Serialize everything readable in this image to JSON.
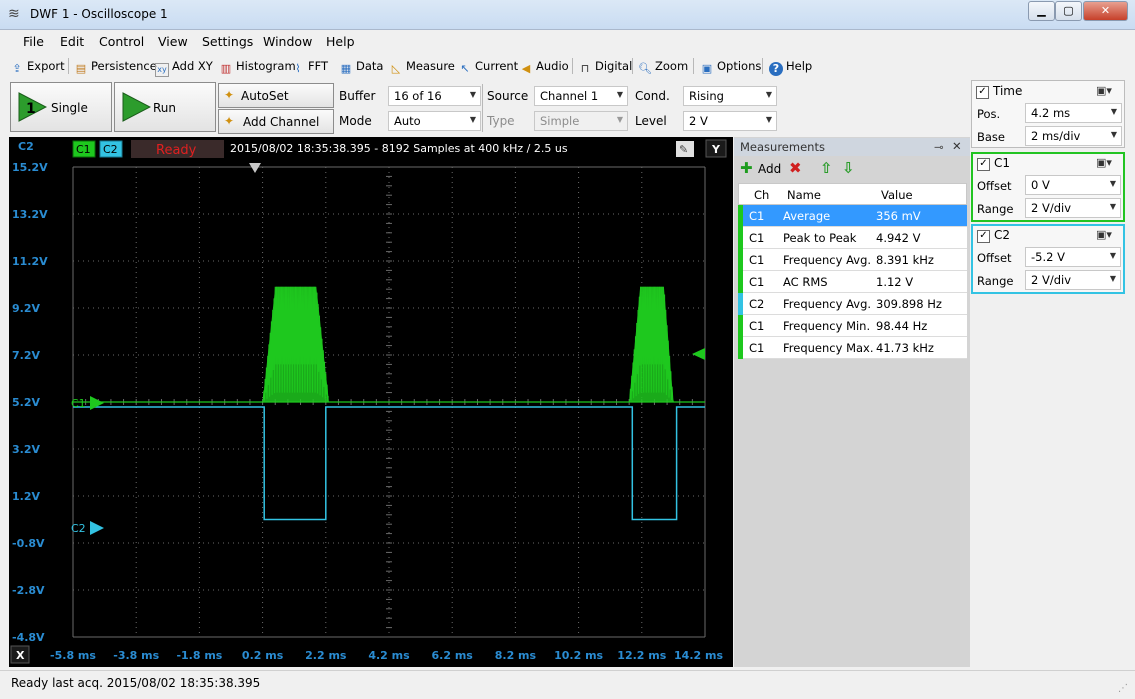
{
  "window": {
    "title": "DWF 1 - Oscilloscope 1"
  },
  "menu": [
    "File",
    "Edit",
    "Control",
    "View",
    "Settings",
    "Window",
    "Help"
  ],
  "toolbar": {
    "export": "Export",
    "persistence": "Persistence",
    "add_xy": "Add XY",
    "histogram": "Histogram",
    "fft": "FFT",
    "data": "Data",
    "measure": "Measure",
    "current": "Current",
    "audio": "Audio",
    "digital": "Digital",
    "zoom": "Zoom",
    "options": "Options",
    "help": "Help"
  },
  "controls": {
    "single_label": "Single",
    "single_badge": "1",
    "run_label": "Run",
    "autoset_label": "AutoSet",
    "add_channel_label": "Add Channel",
    "buffer_label": "Buffer",
    "buffer_value": "16 of 16",
    "mode_label": "Mode",
    "mode_value": "Auto",
    "source_label": "Source",
    "source_value": "Channel 1",
    "type_label": "Type",
    "type_value": "Simple",
    "cond_label": "Cond.",
    "cond_value": "Rising",
    "level_label": "Level",
    "level_value": "2 V"
  },
  "scope": {
    "c2_corner": "C2",
    "ch1_tab": "C1",
    "ch2_tab": "C2",
    "state": "Ready",
    "info": "2015/08/02  18:35:38.395 - 8192 Samples at 400 kHz / 2.5 us",
    "y_button": "Y",
    "x_button": "X",
    "y_labels": [
      "15.2V",
      "13.2V",
      "11.2V",
      "9.2V",
      "7.2V",
      "5.2V",
      "3.2V",
      "1.2V",
      "-0.8V",
      "-2.8V",
      "-4.8V"
    ],
    "x_labels": [
      "-5.8 ms",
      "-3.8 ms",
      "-1.8 ms",
      "0.2 ms",
      "2.2 ms",
      "4.2 ms",
      "6.2 ms",
      "8.2 ms",
      "10.2 ms",
      "12.2 ms",
      "14.2 ms"
    ],
    "c1_marker": "C1",
    "c2_marker": "C2",
    "colors": {
      "c1": "#1ec81e",
      "c2": "#33c3e3",
      "grid": "#6a6a6a",
      "label": "#2a8cd2",
      "ready": "#e02020"
    }
  },
  "measurements": {
    "title": "Measurements",
    "add_label": "Add",
    "headers": {
      "ch": "Ch",
      "name": "Name",
      "value": "Value"
    },
    "rows": [
      {
        "ch": "C1",
        "name": "Average",
        "value": "356 mV",
        "selected": true
      },
      {
        "ch": "C1",
        "name": "Peak to Peak",
        "value": "4.942 V"
      },
      {
        "ch": "C1",
        "name": "Frequency Avg.",
        "value": "8.391 kHz"
      },
      {
        "ch": "C1",
        "name": "AC RMS",
        "value": "1.12 V"
      },
      {
        "ch": "C2",
        "name": "Frequency Avg.",
        "value": "309.898 Hz"
      },
      {
        "ch": "C1",
        "name": "Frequency Min.",
        "value": "98.44 Hz"
      },
      {
        "ch": "C1",
        "name": "Frequency Max.",
        "value": "41.73 kHz"
      }
    ]
  },
  "time_panel": {
    "title": "Time",
    "pos_label": "Pos.",
    "pos_value": "4.2 ms",
    "base_label": "Base",
    "base_value": "2 ms/div"
  },
  "c1_panel": {
    "title": "C1",
    "offset_label": "Offset",
    "offset_value": "0 V",
    "range_label": "Range",
    "range_value": "2 V/div"
  },
  "c2_panel": {
    "title": "C2",
    "offset_label": "Offset",
    "offset_value": "-5.2 V",
    "range_label": "Range",
    "range_value": "2 V/div"
  },
  "status": {
    "text": "Ready last acq. 2015/08/02  18:35:38.395"
  }
}
